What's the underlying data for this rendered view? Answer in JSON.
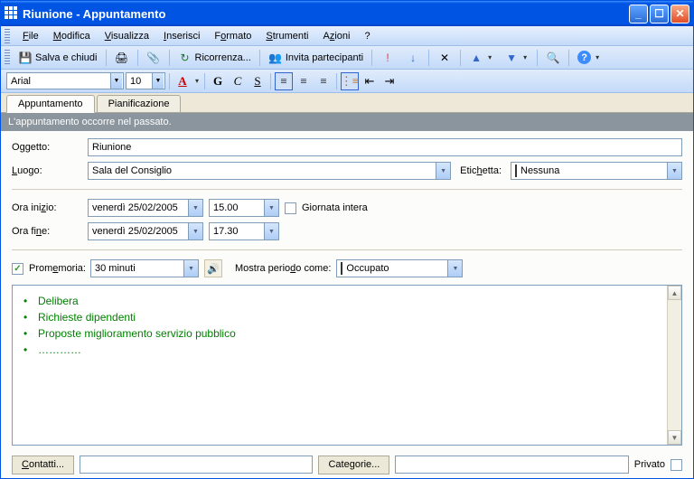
{
  "window": {
    "title": "Riunione - Appuntamento"
  },
  "menu": {
    "file": "File",
    "modifica": "Modifica",
    "visualizza": "Visualizza",
    "inserisci": "Inserisci",
    "formato": "Formato",
    "strumenti": "Strumenti",
    "azioni": "Azioni",
    "help": "?"
  },
  "toolbar": {
    "salva": "Salva e chiudi",
    "ricorrenza": "Ricorrenza...",
    "invita": "Invita partecipanti"
  },
  "format": {
    "font": "Arial",
    "size": "10",
    "boldGlyph": "G",
    "italicGlyph": "C",
    "underlineGlyph": "S"
  },
  "tabs": {
    "appuntamento": "Appuntamento",
    "pianificazione": "Pianificazione"
  },
  "info": "L'appuntamento occorre nel passato.",
  "fields": {
    "oggetto_lbl": "Oggetto:",
    "oggetto_val": "Riunione",
    "luogo_lbl": "Luogo:",
    "luogo_val": "Sala del Consiglio",
    "etichetta_lbl": "Etichetta:",
    "etichetta_val": "Nessuna",
    "orainizio_lbl": "Ora inizio:",
    "orafine_lbl": "Ora fine:",
    "data_inizio": "venerdì 25/02/2005",
    "ora_inizio": "15.00",
    "data_fine": "venerdì 25/02/2005",
    "ora_fine": "17.30",
    "giornata_intera": "Giornata intera",
    "promemoria_lbl": "Promemoria:",
    "promemoria_val": "30 minuti",
    "periodo_lbl": "Mostra periodo come:",
    "periodo_val": "Occupato"
  },
  "notes": [
    "Delibera",
    "Richieste dipendenti",
    "Proposte miglioramento servizio pubblico",
    "…………"
  ],
  "bottom": {
    "contatti": "Contatti...",
    "categorie": "Categorie...",
    "privato": "Privato"
  },
  "colors": {
    "occupato": "#0033CC"
  }
}
